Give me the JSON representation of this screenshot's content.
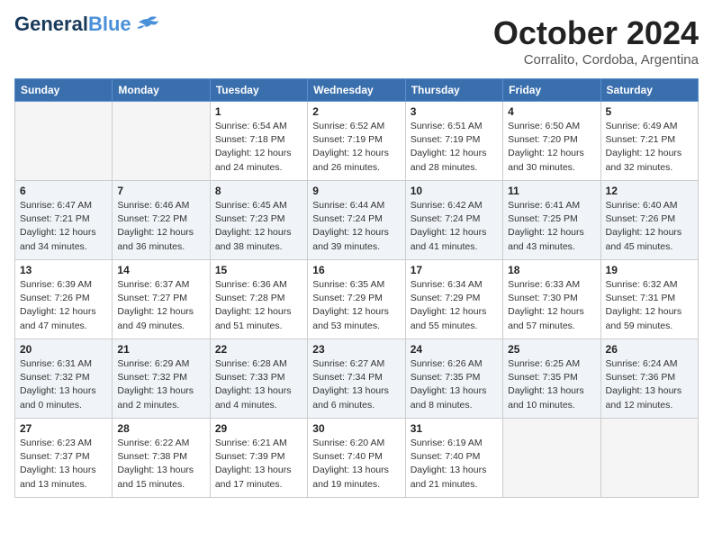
{
  "header": {
    "logo": {
      "general": "General",
      "blue": "Blue"
    },
    "title": "October 2024",
    "location": "Corralito, Cordoba, Argentina"
  },
  "weekdays": [
    "Sunday",
    "Monday",
    "Tuesday",
    "Wednesday",
    "Thursday",
    "Friday",
    "Saturday"
  ],
  "weeks": [
    [
      {
        "day": "",
        "info": ""
      },
      {
        "day": "",
        "info": ""
      },
      {
        "day": "1",
        "info": "Sunrise: 6:54 AM\nSunset: 7:18 PM\nDaylight: 12 hours\nand 24 minutes."
      },
      {
        "day": "2",
        "info": "Sunrise: 6:52 AM\nSunset: 7:19 PM\nDaylight: 12 hours\nand 26 minutes."
      },
      {
        "day": "3",
        "info": "Sunrise: 6:51 AM\nSunset: 7:19 PM\nDaylight: 12 hours\nand 28 minutes."
      },
      {
        "day": "4",
        "info": "Sunrise: 6:50 AM\nSunset: 7:20 PM\nDaylight: 12 hours\nand 30 minutes."
      },
      {
        "day": "5",
        "info": "Sunrise: 6:49 AM\nSunset: 7:21 PM\nDaylight: 12 hours\nand 32 minutes."
      }
    ],
    [
      {
        "day": "6",
        "info": "Sunrise: 6:47 AM\nSunset: 7:21 PM\nDaylight: 12 hours\nand 34 minutes."
      },
      {
        "day": "7",
        "info": "Sunrise: 6:46 AM\nSunset: 7:22 PM\nDaylight: 12 hours\nand 36 minutes."
      },
      {
        "day": "8",
        "info": "Sunrise: 6:45 AM\nSunset: 7:23 PM\nDaylight: 12 hours\nand 38 minutes."
      },
      {
        "day": "9",
        "info": "Sunrise: 6:44 AM\nSunset: 7:24 PM\nDaylight: 12 hours\nand 39 minutes."
      },
      {
        "day": "10",
        "info": "Sunrise: 6:42 AM\nSunset: 7:24 PM\nDaylight: 12 hours\nand 41 minutes."
      },
      {
        "day": "11",
        "info": "Sunrise: 6:41 AM\nSunset: 7:25 PM\nDaylight: 12 hours\nand 43 minutes."
      },
      {
        "day": "12",
        "info": "Sunrise: 6:40 AM\nSunset: 7:26 PM\nDaylight: 12 hours\nand 45 minutes."
      }
    ],
    [
      {
        "day": "13",
        "info": "Sunrise: 6:39 AM\nSunset: 7:26 PM\nDaylight: 12 hours\nand 47 minutes."
      },
      {
        "day": "14",
        "info": "Sunrise: 6:37 AM\nSunset: 7:27 PM\nDaylight: 12 hours\nand 49 minutes."
      },
      {
        "day": "15",
        "info": "Sunrise: 6:36 AM\nSunset: 7:28 PM\nDaylight: 12 hours\nand 51 minutes."
      },
      {
        "day": "16",
        "info": "Sunrise: 6:35 AM\nSunset: 7:29 PM\nDaylight: 12 hours\nand 53 minutes."
      },
      {
        "day": "17",
        "info": "Sunrise: 6:34 AM\nSunset: 7:29 PM\nDaylight: 12 hours\nand 55 minutes."
      },
      {
        "day": "18",
        "info": "Sunrise: 6:33 AM\nSunset: 7:30 PM\nDaylight: 12 hours\nand 57 minutes."
      },
      {
        "day": "19",
        "info": "Sunrise: 6:32 AM\nSunset: 7:31 PM\nDaylight: 12 hours\nand 59 minutes."
      }
    ],
    [
      {
        "day": "20",
        "info": "Sunrise: 6:31 AM\nSunset: 7:32 PM\nDaylight: 13 hours\nand 0 minutes."
      },
      {
        "day": "21",
        "info": "Sunrise: 6:29 AM\nSunset: 7:32 PM\nDaylight: 13 hours\nand 2 minutes."
      },
      {
        "day": "22",
        "info": "Sunrise: 6:28 AM\nSunset: 7:33 PM\nDaylight: 13 hours\nand 4 minutes."
      },
      {
        "day": "23",
        "info": "Sunrise: 6:27 AM\nSunset: 7:34 PM\nDaylight: 13 hours\nand 6 minutes."
      },
      {
        "day": "24",
        "info": "Sunrise: 6:26 AM\nSunset: 7:35 PM\nDaylight: 13 hours\nand 8 minutes."
      },
      {
        "day": "25",
        "info": "Sunrise: 6:25 AM\nSunset: 7:35 PM\nDaylight: 13 hours\nand 10 minutes."
      },
      {
        "day": "26",
        "info": "Sunrise: 6:24 AM\nSunset: 7:36 PM\nDaylight: 13 hours\nand 12 minutes."
      }
    ],
    [
      {
        "day": "27",
        "info": "Sunrise: 6:23 AM\nSunset: 7:37 PM\nDaylight: 13 hours\nand 13 minutes."
      },
      {
        "day": "28",
        "info": "Sunrise: 6:22 AM\nSunset: 7:38 PM\nDaylight: 13 hours\nand 15 minutes."
      },
      {
        "day": "29",
        "info": "Sunrise: 6:21 AM\nSunset: 7:39 PM\nDaylight: 13 hours\nand 17 minutes."
      },
      {
        "day": "30",
        "info": "Sunrise: 6:20 AM\nSunset: 7:40 PM\nDaylight: 13 hours\nand 19 minutes."
      },
      {
        "day": "31",
        "info": "Sunrise: 6:19 AM\nSunset: 7:40 PM\nDaylight: 13 hours\nand 21 minutes."
      },
      {
        "day": "",
        "info": ""
      },
      {
        "day": "",
        "info": ""
      }
    ]
  ]
}
